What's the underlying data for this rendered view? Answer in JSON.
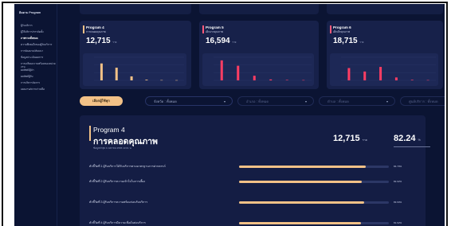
{
  "app": {
    "sidebar_title": "ติดตาม Program",
    "sidebar_items": [
      "ผู้รับบริการ",
      "ผู้ให้บริการ/การจัดตั้ง",
      "ภาพรวมทั้งหมด",
      "ความพึงพอใจของผู้รับบริการ",
      "การจัดอบรม/สัมมนา",
      "ข้อมูลประเมินผลการ",
      "การเตรียมความพร้อมของหน่วยงาน",
      "ผลลัพธ์/ผู้นำ",
      "ผลลัพธ์ผู้รับ",
      "การบริหารจัดการ",
      "แผนงาน/ความร่วมมือ"
    ],
    "sidebar_active_index": 2
  },
  "top_cards": [
    {
      "title": "Program 4",
      "subtitle": "การคลอดคุณภาพ",
      "value": "12,715",
      "unit": "ราย",
      "color": "#f2c187",
      "bars": [
        {
          "v": 2200,
          "c": "#f2c187"
        },
        {
          "v": 1650,
          "c": "#f2c187"
        },
        {
          "v": 520,
          "c": "#f2c187"
        },
        {
          "v": 90,
          "c": "#f2c187"
        },
        {
          "v": 40,
          "c": "#f2c187"
        },
        {
          "v": 30,
          "c": "#f2c187"
        }
      ]
    },
    {
      "title": "Program 5",
      "subtitle": "เด็กแรกคุณภาพ",
      "value": "16,594",
      "unit": "ราย",
      "color": "#ff5a7a",
      "bars": [
        {
          "v": 2600,
          "c": "#ff3d63"
        },
        {
          "v": 1900,
          "c": "#ff3d63"
        },
        {
          "v": 600,
          "c": "#ff3d63"
        },
        {
          "v": 120,
          "c": "#ff3d63"
        },
        {
          "v": 60,
          "c": "#ff3d63"
        },
        {
          "v": 40,
          "c": "#ff3d63"
        }
      ]
    },
    {
      "title": "Program 6",
      "subtitle": "เด็กเล็กคุณภาพ",
      "value": "18,715",
      "unit": "ราย",
      "color": "#ff5a7a",
      "bars": [
        {
          "v": 1600,
          "c": "#ff3d63"
        },
        {
          "v": 1150,
          "c": "#ff3d63"
        },
        {
          "v": 1750,
          "c": "#ff3d63"
        },
        {
          "v": 380,
          "c": "#ff3d63"
        },
        {
          "v": 70,
          "c": "#ff3d63"
        },
        {
          "v": 40,
          "c": "#ff3d63"
        }
      ]
    }
  ],
  "filters": {
    "active_label": "เลือกผู้ใช้ทุก",
    "dropdowns": [
      "จังหวัด : ทั้งหมด",
      "อำเภอ : ทั้งหมด",
      "ตำบล : ทั้งหมด",
      "ศูนย์บริการ : ทั้งหมด"
    ]
  },
  "panel": {
    "title": "Program 4",
    "subtitle": "การคลอดคุณภาพ",
    "note": "ข้อมูลล่าสุด 4 เมษายน 2565 13:01 น.",
    "count": "12,715",
    "count_unit": "ราย",
    "score": "82.24",
    "score_unit": "%",
    "rows": [
      {
        "label": "ตัวชี้วัดที่ 1 ผู้รับบริการได้รับบริการตามมาตรฐานการฝากครรภ์",
        "pct": "84.70%",
        "value": 0.847
      },
      {
        "label": "ตัวชี้วัดที่ 2 ผู้รับบริการความเข้าใจในการเลี้ยง",
        "pct": "82.02%",
        "value": 0.82
      },
      {
        "label": "ตัวชี้วัดที่ 3 ผู้รับบริการความพร้อมก่อนรับบริการ",
        "pct": "83.60%",
        "value": 0.836
      },
      {
        "label": "ตัวชี้วัดที่ 4 ผู้รับบริการมีความเชื่อมั่นต่อบริการ",
        "pct": "81.62%",
        "value": 0.816
      }
    ]
  }
}
